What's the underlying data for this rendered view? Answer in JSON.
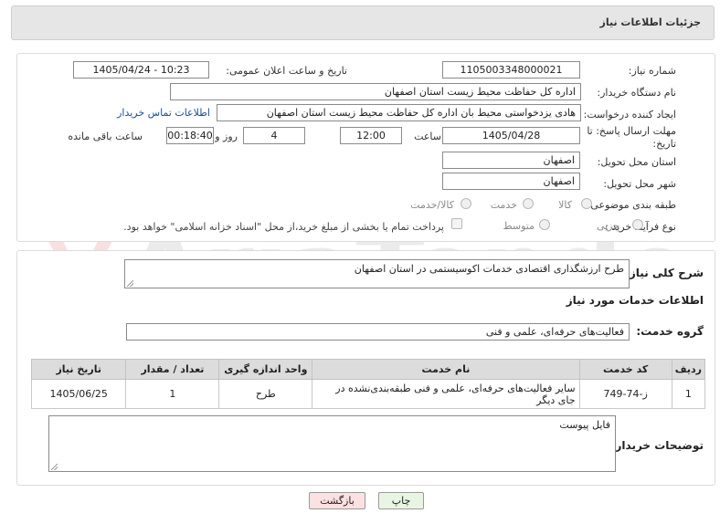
{
  "header": {
    "title": "جزئیات اطلاعات نیاز"
  },
  "form": {
    "need_number": {
      "label": "شماره نیاز:",
      "value": "1105003348000021"
    },
    "announce_datetime": {
      "label": "تاریخ و ساعت اعلان عمومی:",
      "value": "1405/04/24 - 10:23"
    },
    "buyer_org": {
      "label": "نام دستگاه خریدار:",
      "value": "اداره کل حفاظت محیط زیست استان اصفهان"
    },
    "requester": {
      "label": "ایجاد کننده درخواست:",
      "value": "هادی یزدخواستی محیط بان اداره کل حفاظت محیط زیست استان اصفهان",
      "contact_link": "اطلاعات تماس خریدار"
    },
    "deadline": {
      "label_line1": "مهلت ارسال پاسخ: تا",
      "label_line2": "تاریخ:",
      "date": "1405/04/28",
      "time_label": "ساعت",
      "time": "12:00",
      "days": "4",
      "days_label": "روز و",
      "remaining": "00:18:40",
      "remaining_label": "ساعت باقی مانده"
    },
    "delivery_province": {
      "label": "استان محل تحویل:",
      "value": "اصفهان"
    },
    "delivery_city": {
      "label": "شهر محل تحویل:",
      "value": "اصفهان"
    },
    "category": {
      "label": "طبقه بندی موضوعی:",
      "options": [
        "کالا",
        "خدمت",
        "کالا/خدمت"
      ]
    },
    "purchase_type": {
      "label": "نوع فرآیند خرید :",
      "options": [
        "جزیی",
        "متوسط"
      ],
      "payment_note": "پرداخت تمام یا بخشی از مبلغ خرید،از محل \"اسناد خزانه اسلامی\" خواهد بود."
    }
  },
  "summary": {
    "label": "شرح کلی نیاز:",
    "value": "طرح ارزشگذاری اقتصادی خدمات اکوسیستمی در استان اصفهان"
  },
  "services_title": "اطلاعات خدمات مورد نیاز",
  "service_group": {
    "label": "گروه خدمت:",
    "value": "فعالیت‌های حرفه‌ای، علمی و فنی"
  },
  "table": {
    "headers": [
      "ردیف",
      "کد خدمت",
      "نام خدمت",
      "واحد اندازه گیری",
      "تعداد / مقدار",
      "تاریخ نیاز"
    ],
    "rows": [
      [
        "1",
        "ز-74-749",
        "سایر فعالیت‌های حرفه‌ای، علمی و فنی طبقه‌بندی‌نشده در جای دیگر",
        "طرح",
        "1",
        "1405/06/25"
      ]
    ]
  },
  "buyer_notes": {
    "label": "توضیحات خریدار:",
    "value": "فایل پیوست"
  },
  "buttons": {
    "print": "چاپ",
    "back": "بازگشت"
  },
  "watermark": "AriaTender.net"
}
